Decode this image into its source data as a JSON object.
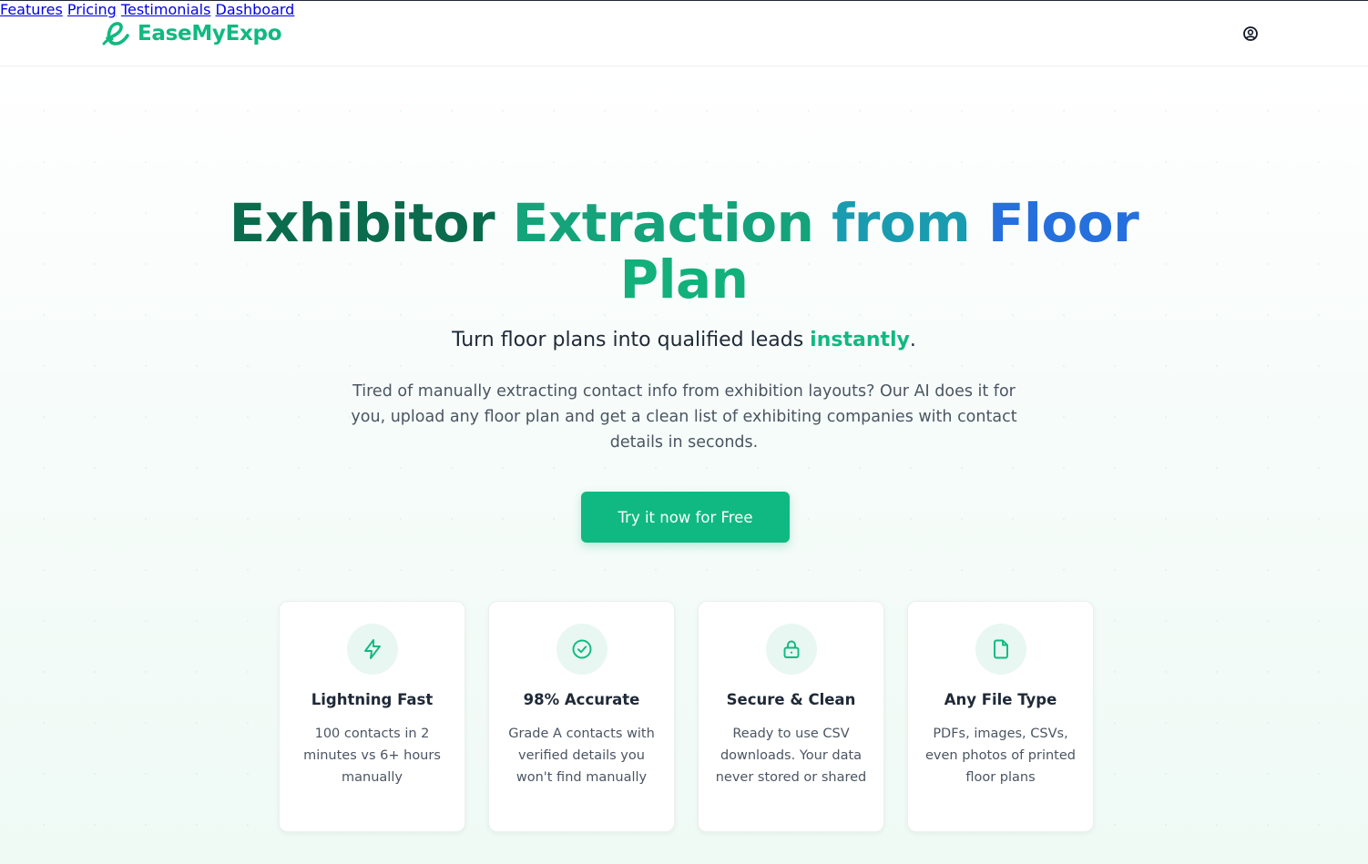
{
  "brand": {
    "name": "EaseMyExpo",
    "accent": "#10b981"
  },
  "nav": {
    "items": [
      {
        "label": "Features"
      },
      {
        "label": "Pricing"
      },
      {
        "label": "Testimonials"
      },
      {
        "label": "Dashboard"
      }
    ],
    "user_icon": "user-circle-icon"
  },
  "hero": {
    "title_parts": [
      "Exhibitor",
      "Extraction",
      "from",
      "Floor",
      "Plan"
    ],
    "subtitle_prefix": "Turn floor plans into qualified leads ",
    "subtitle_highlight": "instantly",
    "subtitle_suffix": ".",
    "description": "Tired of manually extracting contact info from exhibition layouts? Our AI does it for you, upload any floor plan and get a clean list of exhibiting companies with contact details in seconds.",
    "cta_label": "Try it now for Free"
  },
  "features": [
    {
      "icon": "lightning-icon",
      "title": "Lightning Fast",
      "description": "100 contacts in 2 minutes vs 6+ hours manually"
    },
    {
      "icon": "check-circle-icon",
      "title": "98% Accurate",
      "description": "Grade A contacts with verified details you won't find manually"
    },
    {
      "icon": "lock-icon",
      "title": "Secure & Clean",
      "description": "Ready to use CSV downloads. Your data never stored or shared"
    },
    {
      "icon": "file-icon",
      "title": "Any File Type",
      "description": "PDFs, images, CSVs, even photos of printed floor plans"
    }
  ]
}
